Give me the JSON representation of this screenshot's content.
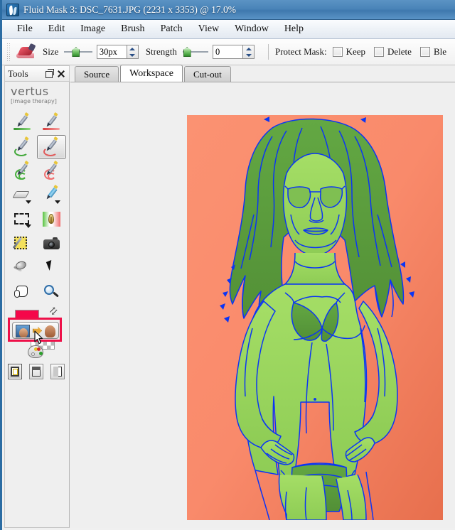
{
  "window": {
    "title": "Fluid Mask 3: DSC_7631.JPG (2231 x 3353) @ 17.0%",
    "app_icon": "fluidmask-app-icon"
  },
  "menu": {
    "items": [
      {
        "label": "File"
      },
      {
        "label": "Edit"
      },
      {
        "label": "Image"
      },
      {
        "label": "Brush"
      },
      {
        "label": "Patch"
      },
      {
        "label": "View"
      },
      {
        "label": "Window"
      },
      {
        "label": "Help"
      }
    ]
  },
  "toolbar": {
    "active_tool_icon": "shoe-brush-icon",
    "size_label": "Size",
    "size_value": "30px",
    "size_slider_percent": 28,
    "strength_label": "Strength",
    "strength_value": "0",
    "strength_slider_percent": 4,
    "protect_mask_label": "Protect Mask:",
    "checkboxes": [
      {
        "label": "Keep",
        "checked": false
      },
      {
        "label": "Delete",
        "checked": false
      },
      {
        "label": "Ble",
        "checked": false
      }
    ]
  },
  "tools_panel": {
    "title": "Tools",
    "float_icon": "restore-icon",
    "close_icon": "close-icon",
    "brand": {
      "name": "vertus",
      "tagline": "[image therapy]"
    },
    "tools": [
      {
        "name": "exact-fill-pen-green",
        "selected": false
      },
      {
        "name": "exact-fill-pen-red",
        "selected": false
      },
      {
        "name": "blend-brush-green",
        "selected": false
      },
      {
        "name": "blend-brush-red",
        "selected": true
      },
      {
        "name": "object-brush-green",
        "selected": false
      },
      {
        "name": "object-brush-red",
        "selected": false
      },
      {
        "name": "eraser",
        "selected": false
      },
      {
        "name": "highlighter",
        "selected": false
      },
      {
        "name": "marquee-select",
        "selected": false
      },
      {
        "name": "blend-pen",
        "selected": false
      },
      {
        "name": "magic-wand",
        "selected": false
      },
      {
        "name": "camera-snapshot",
        "selected": false
      },
      {
        "name": "patch-tool",
        "selected": false
      },
      {
        "name": "pointer",
        "selected": false
      },
      {
        "name": "hand-pan",
        "selected": false
      },
      {
        "name": "zoom",
        "selected": false
      }
    ],
    "swatches": {
      "foreground_color": "#f5074a",
      "background_label": "transparent-checker",
      "swap_icon": "swap-colors-icon"
    },
    "highlighted_button": {
      "name": "cut-out-preview-toggle",
      "highlight_color": "#ee1049",
      "cursor_icon": "mouse-cursor-arrow"
    },
    "palette_icon": "color-palette-icon",
    "layout_buttons": [
      {
        "name": "single-view-layout",
        "selected": true
      },
      {
        "name": "split-horizontal-layout",
        "selected": false
      },
      {
        "name": "split-vertical-layout",
        "selected": false
      }
    ]
  },
  "tabs": [
    {
      "label": "Source",
      "active": false
    },
    {
      "label": "Workspace",
      "active": true
    },
    {
      "label": "Cut-out",
      "active": false
    }
  ],
  "canvas": {
    "name": "workspace-mask-canvas",
    "background_color": "#f98a68",
    "mask_keep_color": "#9ed860",
    "mask_blend_color": "#5a9e3c",
    "edge_color": "#0b35f4",
    "subject": "woman-portrait-mask-overlay"
  }
}
